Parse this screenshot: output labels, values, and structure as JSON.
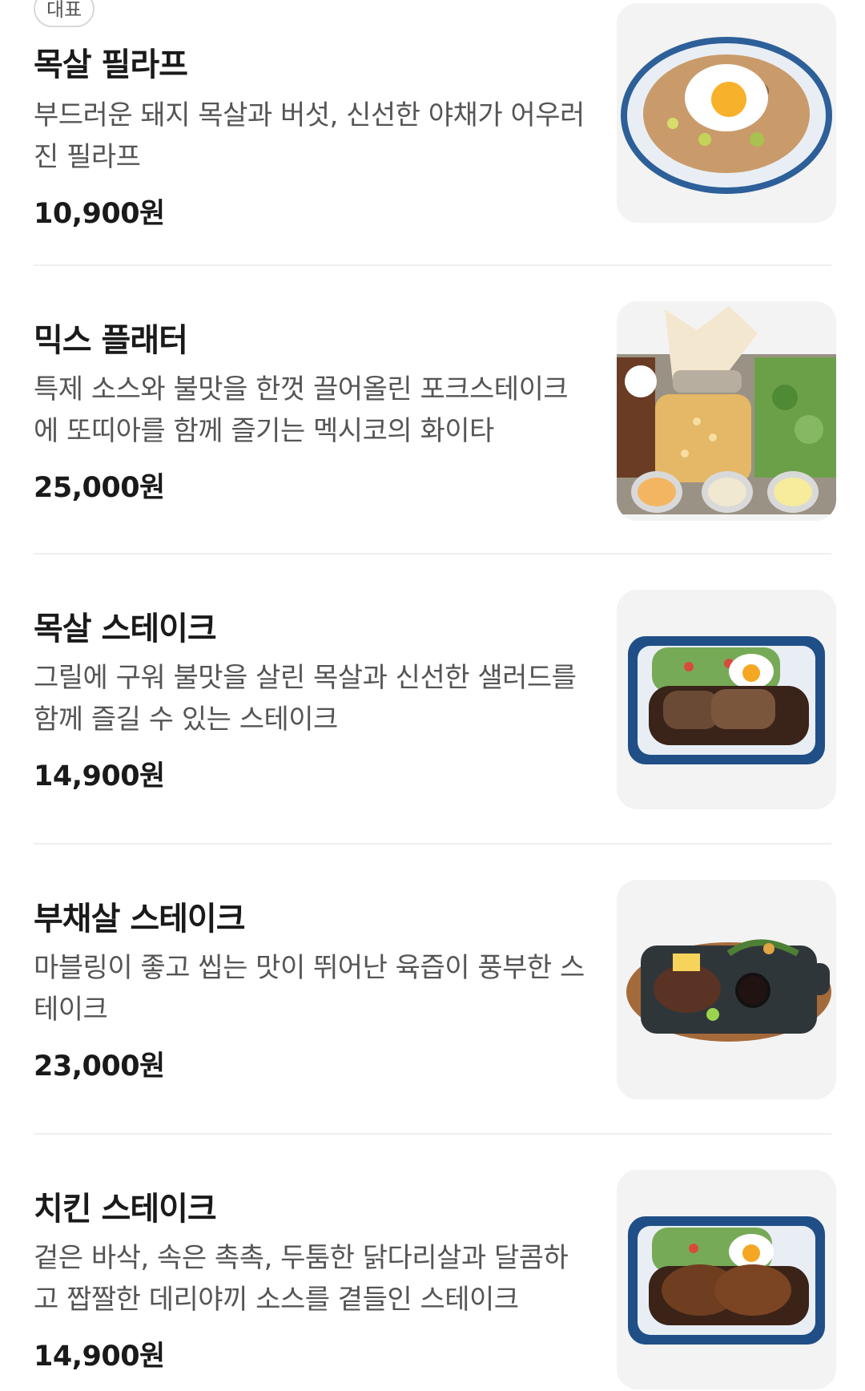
{
  "badge": "대표",
  "items": [
    {
      "name": "목살 필라프",
      "desc": "부드러운 돼지 목살과 버섯, 신선한 야채가 어우러진 필라프",
      "price": "10,900원",
      "image_icon": "pilaf-photo"
    },
    {
      "name": "믹스 플래터",
      "desc": "특제 소스와 불맛을 한껏 끌어올린 포크스테이크에 또띠아를 함께 즐기는 멕시코의 화이타",
      "price": "25,000원",
      "image_icon": "platter-photo"
    },
    {
      "name": "목살 스테이크",
      "desc": "그릴에 구워 불맛을 살린 목살과 신선한 샐러드를 함께 즐길 수 있는 스테이크",
      "price": "14,900원",
      "image_icon": "pork-steak-photo"
    },
    {
      "name": "부채살 스테이크",
      "desc": "마블링이 좋고 씹는 맛이 뛰어난 육즙이 풍부한 스테이크",
      "price": "23,000원",
      "image_icon": "beef-steak-photo"
    },
    {
      "name": "치킨 스테이크",
      "desc": "겉은 바삭, 속은 촉촉, 두툼한 닭다리살과 달콤하고 짭짤한 데리야끼 소스를 곁들인 스테이크",
      "price": "14,900원",
      "image_icon": "chicken-steak-photo"
    }
  ]
}
